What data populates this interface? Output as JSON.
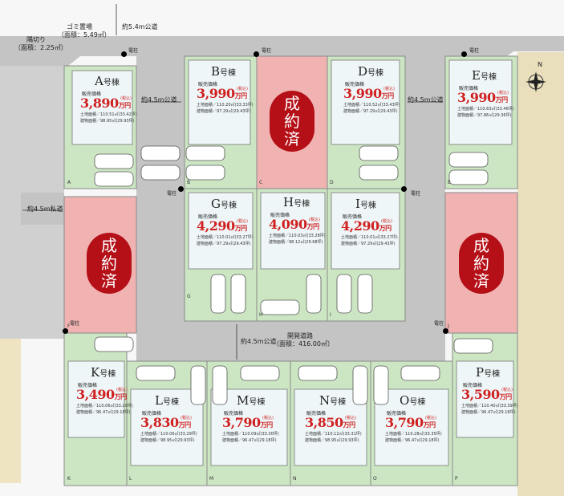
{
  "roads": {
    "top_road": "約5.4m公道",
    "garbage": "ゴミ置場",
    "garbage_area": "（面積：5.49㎡）",
    "corner_cut": "隅切り",
    "corner_cut_area": "（面積：2.25㎡）",
    "left_mid_road": "約4.5m公道",
    "right_mid_road": "約4.5m公道",
    "private_road": "約4.5m私道",
    "bottom_road": "約4.5m公道",
    "dev_road": "開発道路",
    "dev_road_area": "（面積：416.00㎡）"
  },
  "labels": {
    "pole": "電柱",
    "price_label": "販売価格",
    "tax": "(税込)",
    "unit": "万円",
    "suffix": "号棟",
    "sold": [
      "成",
      "約",
      "済"
    ]
  },
  "lots": [
    {
      "id": "A",
      "name": "A",
      "price": "3,890",
      "land": "土地面積／110.51㎡(33.42坪)",
      "building": "建物面積／98.95㎡(29.93坪)"
    },
    {
      "id": "B",
      "name": "B",
      "price": "3,990",
      "land": "土地面積／110.20㎡(33.33坪)",
      "building": "建物面積／97.29㎡(29.43坪)"
    },
    {
      "id": "D",
      "name": "D",
      "price": "3,990",
      "land": "土地面積／110.52㎡(33.43坪)",
      "building": "建物面積／97.29㎡(29.43坪)"
    },
    {
      "id": "E",
      "name": "E",
      "price": "3,990",
      "land": "土地面積／110.63㎡(33.46坪)",
      "building": "建物面積／97.86㎡(29.36坪)"
    },
    {
      "id": "G",
      "name": "G",
      "price": "4,290",
      "land": "土地面積／110.01㎡(33.27坪)",
      "building": "建物面積／97.29㎡(29.43坪)"
    },
    {
      "id": "H",
      "name": "H",
      "price": "4,090",
      "land": "土地面積／110.03㎡(33.28坪)",
      "building": "建物面積／98.12㎡(29.68坪)"
    },
    {
      "id": "I",
      "name": "I",
      "price": "4,290",
      "land": "土地面積／110.01㎡(33.27坪)",
      "building": "建物面積／97.29㎡(29.43坪)"
    },
    {
      "id": "K",
      "name": "K",
      "price": "3,490",
      "land": "土地面積／110.06㎡(33.29坪)",
      "building": "建物面積／96.47㎡(29.18坪)"
    },
    {
      "id": "L",
      "name": "L",
      "price": "3,830",
      "land": "土地面積／110.06㎡(33.29坪)",
      "building": "建物面積／98.95㎡(29.93坪)"
    },
    {
      "id": "M",
      "name": "M",
      "price": "3,790",
      "land": "土地面積／110.09㎡(33.30坪)",
      "building": "建物面積／96.47㎡(29.18坪)"
    },
    {
      "id": "N",
      "name": "N",
      "price": "3,850",
      "land": "土地面積／110.12㎡(33.31坪)",
      "building": "建物面積／98.95㎡(29.93坪)"
    },
    {
      "id": "O",
      "name": "O",
      "price": "3,790",
      "land": "土地面積／110.28㎡(33.35坪)",
      "building": "建物面積／96.47㎡(29.18坪)"
    },
    {
      "id": "P",
      "name": "P",
      "price": "3,590",
      "land": "土地面積／110.40㎡(33.39坪)",
      "building": "建物面積／96.47㎡(29.18坪)"
    }
  ],
  "sold_lots": [
    "C",
    "F",
    "J"
  ],
  "markers": [
    "A",
    "B",
    "C",
    "D",
    "E",
    "F",
    "G",
    "H",
    "I",
    "J",
    "K",
    "L",
    "M",
    "N",
    "O",
    "P"
  ],
  "compass": "N",
  "colors": {
    "lot_green": "#cce6c3",
    "sold_pink": "#f0b3b2",
    "road": "#bfbfbf",
    "house": "#eef6f8",
    "price_red": "#d0201f",
    "sold_badge": "#b50f17"
  }
}
